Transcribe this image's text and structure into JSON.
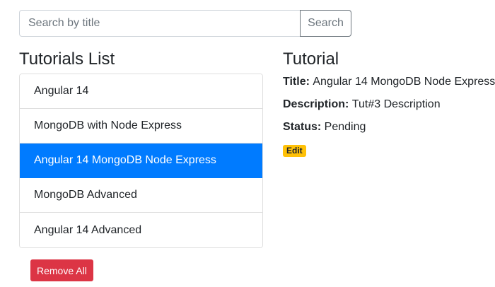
{
  "search": {
    "placeholder": "Search by title",
    "button_label": "Search"
  },
  "list": {
    "heading": "Tutorials List",
    "items": [
      {
        "label": "Angular 14"
      },
      {
        "label": "MongoDB with Node Express"
      },
      {
        "label": "Angular 14 MongoDB Node Express",
        "active": true
      },
      {
        "label": "MongoDB Advanced"
      },
      {
        "label": "Angular 14 Advanced"
      }
    ],
    "remove_all_label": "Remove All"
  },
  "detail": {
    "heading": "Tutorial",
    "title_label": "Title:",
    "title_value": "Angular 14 MongoDB Node Express",
    "description_label": "Description:",
    "description_value": "Tut#3 Description",
    "status_label": "Status:",
    "status_value": "Pending",
    "edit_label": "Edit"
  },
  "colors": {
    "active_item": "#007bff",
    "danger": "#dc3545",
    "warning": "#ffc107"
  }
}
